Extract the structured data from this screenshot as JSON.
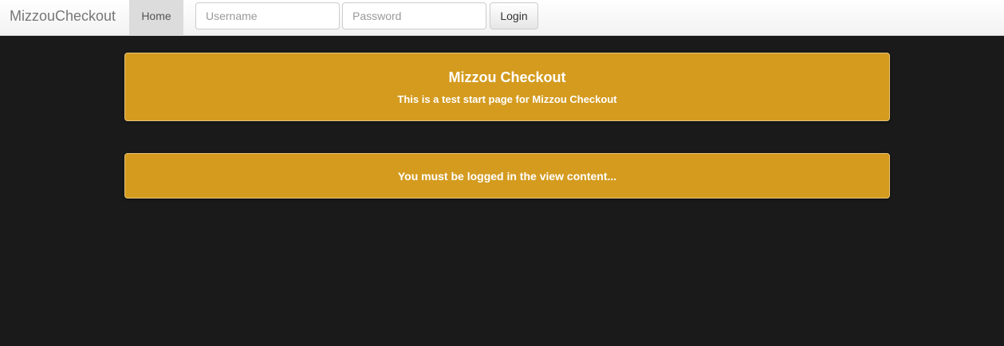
{
  "navbar": {
    "brand": "MizzouCheckout",
    "home_label": "Home",
    "username_placeholder": "Username",
    "password_placeholder": "Password",
    "login_label": "Login"
  },
  "hero": {
    "title": "Mizzou Checkout",
    "subtitle": "This is a test start page for Mizzou Checkout"
  },
  "notice": {
    "text": "You must be logged in the view content..."
  },
  "colors": {
    "page_background": "#1a1a1a",
    "panel_gold": "#d49b1f",
    "panel_text": "#ffffff"
  }
}
